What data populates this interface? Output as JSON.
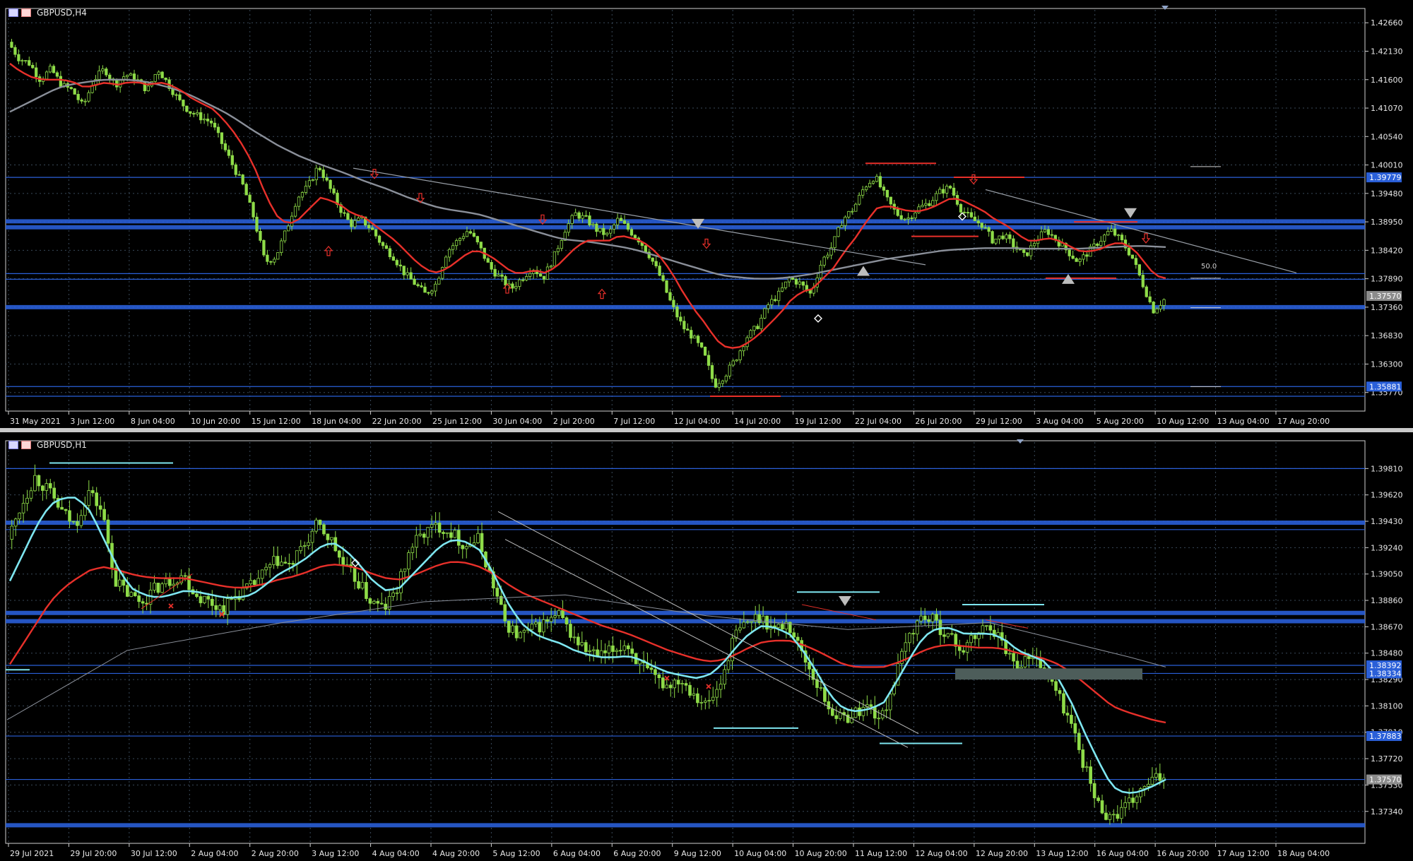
{
  "chart_data": [
    {
      "type": "candlestick",
      "title": "GBPUSD,H4",
      "ylim": [
        1.3545,
        1.429
      ],
      "y_ticks": [
        "1.42660",
        "1.42130",
        "1.41600",
        "1.41070",
        "1.40540",
        "1.40010",
        "1.39480",
        "1.38950",
        "1.38420",
        "1.37890",
        "1.37360",
        "1.36830",
        "1.36300",
        "1.35770"
      ],
      "x_ticks": [
        "31 May 2021",
        "3 Jun 12:00",
        "8 Jun 04:00",
        "10 Jun 20:00",
        "15 Jun 12:00",
        "18 Jun 04:00",
        "22 Jun 20:00",
        "25 Jun 12:00",
        "30 Jun 04:00",
        "2 Jul 20:00",
        "7 Jul 12:00",
        "12 Jul 04:00",
        "14 Jul 20:00",
        "19 Jul 12:00",
        "22 Jul 04:00",
        "26 Jul 20:00",
        "29 Jul 12:00",
        "3 Aug 04:00",
        "5 Aug 20:00",
        "10 Aug 12:00",
        "13 Aug 04:00",
        "17 Aug 20:00"
      ],
      "close_path": [
        1.423,
        1.42,
        1.419,
        1.416,
        1.418,
        1.415,
        1.414,
        1.411,
        1.416,
        1.418,
        1.415,
        1.417,
        1.416,
        1.414,
        1.418,
        1.415,
        1.412,
        1.41,
        1.409,
        1.408,
        1.404,
        1.4,
        1.396,
        1.39,
        1.382,
        1.383,
        1.388,
        1.394,
        1.396,
        1.4,
        1.396,
        1.392,
        1.389,
        1.39,
        1.388,
        1.385,
        1.383,
        1.38,
        1.378,
        1.376,
        1.378,
        1.384,
        1.386,
        1.388,
        1.385,
        1.381,
        1.379,
        1.377,
        1.379,
        1.381,
        1.379,
        1.383,
        1.388,
        1.391,
        1.39,
        1.388,
        1.387,
        1.39,
        1.388,
        1.386,
        1.383,
        1.379,
        1.374,
        1.37,
        1.368,
        1.365,
        1.359,
        1.361,
        1.364,
        1.368,
        1.37,
        1.374,
        1.376,
        1.379,
        1.378,
        1.376,
        1.382,
        1.385,
        1.39,
        1.392,
        1.396,
        1.398,
        1.394,
        1.391,
        1.39,
        1.392,
        1.393,
        1.395,
        1.396,
        1.392,
        1.39,
        1.389,
        1.386,
        1.387,
        1.385,
        1.383,
        1.386,
        1.388,
        1.386,
        1.384,
        1.382,
        1.384,
        1.386,
        1.388,
        1.386,
        1.383,
        1.378,
        1.373,
        1.375
      ],
      "ma_red": [
        1.419,
        1.4175,
        1.4165,
        1.416,
        1.416,
        1.416,
        1.4155,
        1.4145,
        1.415,
        1.4155,
        1.415,
        1.4155,
        1.4155,
        1.415,
        1.4155,
        1.415,
        1.414,
        1.4125,
        1.4115,
        1.4105,
        1.4085,
        1.406,
        1.403,
        1.399,
        1.394,
        1.3905,
        1.389,
        1.39,
        1.392,
        1.394,
        1.3935,
        1.3925,
        1.391,
        1.3905,
        1.389,
        1.3875,
        1.386,
        1.384,
        1.382,
        1.3805,
        1.38,
        1.381,
        1.3825,
        1.384,
        1.384,
        1.383,
        1.3815,
        1.38,
        1.38,
        1.3805,
        1.38,
        1.381,
        1.383,
        1.385,
        1.386,
        1.386,
        1.386,
        1.387,
        1.3865,
        1.386,
        1.3845,
        1.3825,
        1.3795,
        1.376,
        1.373,
        1.3705,
        1.3675,
        1.366,
        1.366,
        1.367,
        1.3685,
        1.3705,
        1.3725,
        1.375,
        1.3765,
        1.377,
        1.379,
        1.381,
        1.384,
        1.3865,
        1.3895,
        1.392,
        1.3925,
        1.392,
        1.3915,
        1.3915,
        1.392,
        1.393,
        1.394,
        1.3935,
        1.3925,
        1.3915,
        1.39,
        1.389,
        1.3875,
        1.386,
        1.386,
        1.3865,
        1.386,
        1.385,
        1.384,
        1.384,
        1.3845,
        1.3855,
        1.3855,
        1.3845,
        1.382,
        1.3795,
        1.379
      ],
      "ma_gray": [
        1.41,
        1.411,
        1.412,
        1.413,
        1.414,
        1.4148,
        1.4152,
        1.4155,
        1.4158,
        1.416,
        1.416,
        1.416,
        1.4158,
        1.4155,
        1.415,
        1.4145,
        1.4138,
        1.413,
        1.412,
        1.411,
        1.41,
        1.4088,
        1.4075,
        1.4062,
        1.405,
        1.4038,
        1.4028,
        1.4018,
        1.401,
        1.4002,
        1.3995,
        1.3988,
        1.398,
        1.3972,
        1.3965,
        1.3958,
        1.395,
        1.3942,
        1.3935,
        1.3928,
        1.3922,
        1.3918,
        1.3915,
        1.3912,
        1.3908,
        1.3902,
        1.3896,
        1.389,
        1.3884,
        1.3878,
        1.3872,
        1.3866,
        1.3862,
        1.386,
        1.3858,
        1.3855,
        1.3852,
        1.3849,
        1.3845,
        1.384,
        1.3834,
        1.3828,
        1.3822,
        1.3816,
        1.381,
        1.3804,
        1.3798,
        1.3794,
        1.3792,
        1.379,
        1.3789,
        1.3789,
        1.379,
        1.3792,
        1.3795,
        1.3798,
        1.3802,
        1.3806,
        1.381,
        1.3814,
        1.3818,
        1.3822,
        1.3826,
        1.3829,
        1.3832,
        1.3835,
        1.3838,
        1.3841,
        1.3843,
        1.3844,
        1.3845,
        1.3846,
        1.3846,
        1.3846,
        1.3846,
        1.3845,
        1.3845,
        1.3845,
        1.3845,
        1.3845,
        1.3845,
        1.3846,
        1.3847,
        1.3848,
        1.3849,
        1.385,
        1.385,
        1.3849,
        1.3848
      ],
      "hlines": [
        {
          "y": 1.3896,
          "thick": true
        },
        {
          "y": 1.3885,
          "thick": true
        },
        {
          "y": 1.37985,
          "thick": false
        },
        {
          "y": 1.3788,
          "thick": false
        },
        {
          "y": 1.3736,
          "thick": true
        },
        {
          "y": 1.39779,
          "thick": false
        },
        {
          "y": 1.35881,
          "thick": false
        },
        {
          "y": 1.357,
          "thick": false
        }
      ],
      "price_badges": [
        {
          "label": "1.39779",
          "y": 1.39779,
          "color": "#2a5fd8"
        },
        {
          "label": "1.37570",
          "y": 1.3757,
          "color": "#8c8c8c"
        },
        {
          "label": "1.35881",
          "y": 1.35881,
          "color": "#2a5fd8"
        }
      ],
      "annotation": "50.0"
    },
    {
      "type": "candlestick",
      "title": "GBPUSD,H1",
      "ylim": [
        1.3712,
        1.4
      ],
      "y_ticks": [
        "1.39810",
        "1.39620",
        "1.39430",
        "1.39240",
        "1.39050",
        "1.38860",
        "1.38670",
        "1.38480",
        "1.38290",
        "1.38100",
        "1.37910",
        "1.37720",
        "1.37530",
        "1.37340"
      ],
      "x_ticks": [
        "29 Jul 2021",
        "29 Jul 20:00",
        "30 Jul 12:00",
        "2 Aug 04:00",
        "2 Aug 20:00",
        "3 Aug 12:00",
        "4 Aug 04:00",
        "4 Aug 20:00",
        "5 Aug 12:00",
        "6 Aug 04:00",
        "6 Aug 20:00",
        "9 Aug 12:00",
        "10 Aug 04:00",
        "10 Aug 20:00",
        "11 Aug 12:00",
        "12 Aug 04:00",
        "12 Aug 20:00",
        "13 Aug 12:00",
        "16 Aug 04:00",
        "16 Aug 20:00",
        "17 Aug 12:00",
        "18 Aug 04:00"
      ],
      "close_path": [
        1.393,
        1.3955,
        1.3975,
        1.3965,
        1.395,
        1.394,
        1.3965,
        1.395,
        1.39,
        1.389,
        1.3885,
        1.3895,
        1.39,
        1.3905,
        1.389,
        1.3885,
        1.388,
        1.389,
        1.3895,
        1.3905,
        1.3915,
        1.391,
        1.3925,
        1.394,
        1.393,
        1.391,
        1.39,
        1.3885,
        1.388,
        1.3895,
        1.3925,
        1.3935,
        1.394,
        1.3935,
        1.3925,
        1.393,
        1.39,
        1.387,
        1.386,
        1.3865,
        1.387,
        1.3875,
        1.386,
        1.385,
        1.3845,
        1.385,
        1.3855,
        1.384,
        1.383,
        1.3825,
        1.383,
        1.382,
        1.381,
        1.3825,
        1.386,
        1.387,
        1.3875,
        1.3865,
        1.387,
        1.385,
        1.383,
        1.381,
        1.38,
        1.3805,
        1.381,
        1.38,
        1.383,
        1.386,
        1.3875,
        1.387,
        1.386,
        1.385,
        1.386,
        1.387,
        1.3855,
        1.384,
        1.3845,
        1.384,
        1.382,
        1.38,
        1.377,
        1.374,
        1.373,
        1.3735,
        1.3745,
        1.3755,
        1.376
      ],
      "ma_cyan": [
        1.39,
        1.392,
        1.394,
        1.3955,
        1.396,
        1.396,
        1.395,
        1.393,
        1.391,
        1.3895,
        1.389,
        1.3888,
        1.389,
        1.3893,
        1.3892,
        1.389,
        1.3888,
        1.3888,
        1.389,
        1.3897,
        1.3905,
        1.391,
        1.3916,
        1.3924,
        1.3928,
        1.3922,
        1.3912,
        1.39,
        1.3893,
        1.3895,
        1.3905,
        1.3915,
        1.3925,
        1.393,
        1.3928,
        1.3922,
        1.3905,
        1.3885,
        1.387,
        1.3862,
        1.3858,
        1.3855,
        1.385,
        1.3847,
        1.3845,
        1.3845,
        1.3846,
        1.3843,
        1.3838,
        1.3834,
        1.3832,
        1.383,
        1.3832,
        1.384,
        1.3852,
        1.3862,
        1.3868,
        1.3866,
        1.3862,
        1.385,
        1.3835,
        1.3818,
        1.3808,
        1.3806,
        1.3808,
        1.3812,
        1.3828,
        1.3845,
        1.386,
        1.3866,
        1.3866,
        1.3862,
        1.3862,
        1.3862,
        1.3858,
        1.385,
        1.3846,
        1.3842,
        1.383,
        1.3812,
        1.379,
        1.377,
        1.3752,
        1.3747,
        1.3748,
        1.3752,
        1.3757
      ],
      "ma_red": [
        1.384,
        1.3855,
        1.387,
        1.3885,
        1.3895,
        1.3902,
        1.3908,
        1.391,
        1.3908,
        1.3905,
        1.3903,
        1.3902,
        1.3902,
        1.3902,
        1.39,
        1.3898,
        1.3896,
        1.3895,
        1.3896,
        1.3898,
        1.3901,
        1.3903,
        1.3906,
        1.391,
        1.3912,
        1.3911,
        1.3909,
        1.3905,
        1.3902,
        1.3901,
        1.3904,
        1.3908,
        1.3912,
        1.3914,
        1.3913,
        1.391,
        1.3905,
        1.3898,
        1.3892,
        1.3888,
        1.3884,
        1.388,
        1.3876,
        1.3872,
        1.3868,
        1.3865,
        1.3862,
        1.3858,
        1.3854,
        1.385,
        1.3847,
        1.3844,
        1.3842,
        1.3843,
        1.3847,
        1.3852,
        1.3856,
        1.3857,
        1.3857,
        1.3854,
        1.385,
        1.3845,
        1.384,
        1.3838,
        1.3838,
        1.3838,
        1.3841,
        1.3845,
        1.385,
        1.3853,
        1.3854,
        1.3853,
        1.3852,
        1.3852,
        1.3851,
        1.3848,
        1.3846,
        1.3844,
        1.384,
        1.3834,
        1.3826,
        1.3818,
        1.381,
        1.3806,
        1.3803,
        1.38,
        1.3798
      ],
      "hlines": [
        {
          "y": 1.3981,
          "thick": false
        },
        {
          "y": 1.3942,
          "thick": true
        },
        {
          "y": 1.3937,
          "thick": false
        },
        {
          "y": 1.3877,
          "thick": true
        },
        {
          "y": 1.3871,
          "thick": true
        },
        {
          "y": 1.38392,
          "thick": false
        },
        {
          "y": 1.38334,
          "thick": false
        },
        {
          "y": 1.37883,
          "thick": false
        },
        {
          "y": 1.3757,
          "thick": false
        },
        {
          "y": 1.3724,
          "thick": true
        }
      ],
      "price_badges": [
        {
          "label": "1.38392",
          "y": 1.38392,
          "color": "#2a5fd8"
        },
        {
          "label": "1.38334",
          "y": 1.38334,
          "color": "#2a5fd8"
        },
        {
          "label": "1.37883",
          "y": 1.37883,
          "color": "#2a5fd8"
        },
        {
          "label": "1.37570",
          "y": 1.3757,
          "color": "#8c8c8c"
        }
      ]
    }
  ],
  "colors": {
    "background": "#000000",
    "grid": "#3a4a5a",
    "candle": "#8edc48",
    "ma_red": "#e8302a",
    "ma_gray": "#8a8f99",
    "ma_cyan": "#7ee6f0",
    "level": "#2a5fd8",
    "axis_text": "#e8e8e8"
  }
}
